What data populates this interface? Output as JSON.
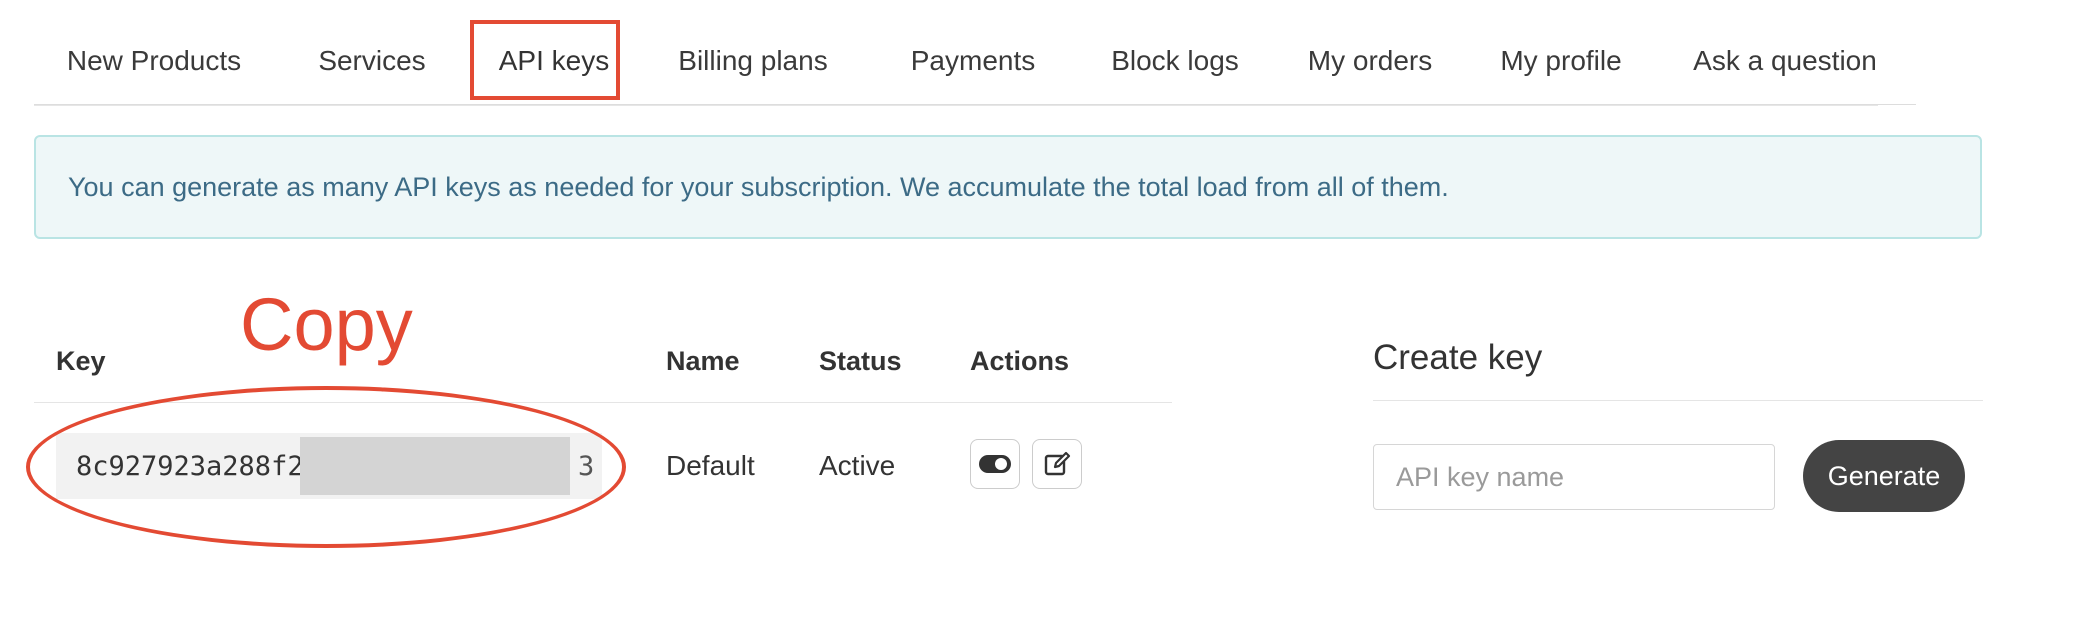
{
  "tabs": [
    {
      "label": "New Products",
      "active": false
    },
    {
      "label": "Services",
      "active": false
    },
    {
      "label": "API keys",
      "active": true
    },
    {
      "label": "Billing plans",
      "active": false
    },
    {
      "label": "Payments",
      "active": false
    },
    {
      "label": "Block logs",
      "active": false
    },
    {
      "label": "My orders",
      "active": false
    },
    {
      "label": "My profile",
      "active": false
    },
    {
      "label": "Ask a question",
      "active": false
    }
  ],
  "alert": {
    "text": "You can generate as many API keys as needed for your subscription. We accumulate the total load from all of them."
  },
  "annotation": {
    "copy_label": "Copy",
    "color": "#e34a33"
  },
  "keys_table": {
    "headers": {
      "key": "Key",
      "name": "Name",
      "status": "Status",
      "actions": "Actions"
    },
    "rows": [
      {
        "key_prefix": "8c927923a288f2",
        "key_suffix": "3",
        "name": "Default",
        "status": "Active",
        "actions": [
          "toggle-icon",
          "edit-icon"
        ]
      }
    ]
  },
  "create_key": {
    "title": "Create key",
    "input_placeholder": "API key name",
    "input_value": "",
    "button_label": "Generate"
  },
  "colors": {
    "alert_text": "#3c6b86",
    "alert_bg": "#eef7f8",
    "alert_border": "#b9e4e4",
    "button_bg": "#444444"
  }
}
